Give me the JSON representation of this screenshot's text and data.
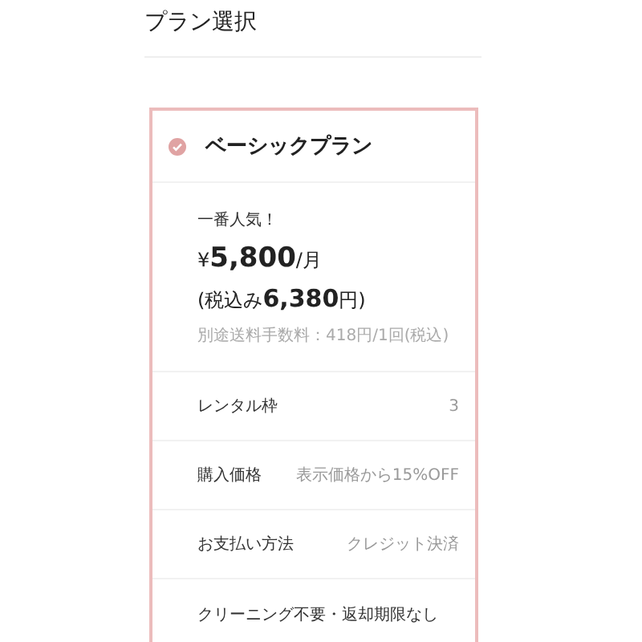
{
  "page_title": "プラン選択",
  "plan": {
    "name": "ベーシックプラン",
    "selected": true,
    "tagline": "一番人気！",
    "price": "¥**5,800**/月",
    "price_tax": "(税込み**6,380**円)",
    "note": "別途送料手数料：418円/1回(税込)",
    "rows": [
      {
        "label": "レンタル枠",
        "value": "3"
      },
      {
        "label": "購入価格",
        "value": "表示価格から15%OFF"
      },
      {
        "label": "お支払い方法",
        "value": "クレジット決済"
      }
    ],
    "footer": "クリーニング不要・返却期限なし"
  }
}
